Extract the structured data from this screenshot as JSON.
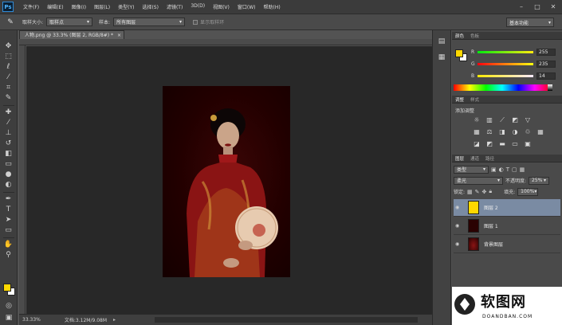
{
  "app": {
    "logo": "Ps"
  },
  "menu": [
    "文件(F)",
    "编辑(E)",
    "图像(I)",
    "图层(L)",
    "类型(Y)",
    "选择(S)",
    "滤镜(T)",
    "3D(D)",
    "视图(V)",
    "窗口(W)",
    "帮助(H)"
  ],
  "options_bar": {
    "sample_size_label": "取样大小:",
    "sample_size_value": "取样点",
    "sample_label": "样本:",
    "sample_value": "所有图层",
    "show_ring_label": "显示取样环",
    "workspace": "基本功能"
  },
  "document": {
    "tab_title": "人物.png @ 33.3% (图层 2, RGB/8#) *",
    "zoom": "33.33%",
    "doc_info": "文档:3.12M/9.08M"
  },
  "color_panel": {
    "tabs": [
      "颜色",
      "色板"
    ],
    "fg_color": "#ffd800",
    "channels": [
      {
        "label": "R",
        "value": "255"
      },
      {
        "label": "G",
        "value": "235"
      },
      {
        "label": "B",
        "value": "14"
      }
    ]
  },
  "adjustments_panel": {
    "tabs": [
      "调整",
      "样式"
    ],
    "title": "添加调整"
  },
  "layers_panel": {
    "tabs": [
      "图层",
      "通道",
      "路径"
    ],
    "filter_kind": "类型",
    "blend_mode": "柔光",
    "opacity_label": "不透明度:",
    "opacity_value": "25%",
    "lock_label": "锁定:",
    "fill_label": "填充:",
    "fill_value": "100%",
    "layers": [
      {
        "name": "图层 2",
        "selected": true
      },
      {
        "name": "图层 1",
        "selected": false
      },
      {
        "name": "背景图层",
        "selected": false
      }
    ]
  },
  "watermark": {
    "text": "DOANDBAN.COM",
    "brand": "软图网"
  }
}
